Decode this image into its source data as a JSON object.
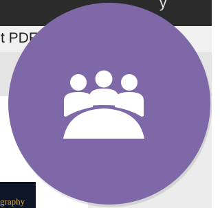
{
  "window": {
    "title_fragment": "y"
  },
  "toolbar": {
    "text": "t PDF"
  },
  "thumbnail": {
    "text": "graphy"
  },
  "badge": {
    "icon": "meeting-group-icon",
    "color": "#7f68a8"
  }
}
